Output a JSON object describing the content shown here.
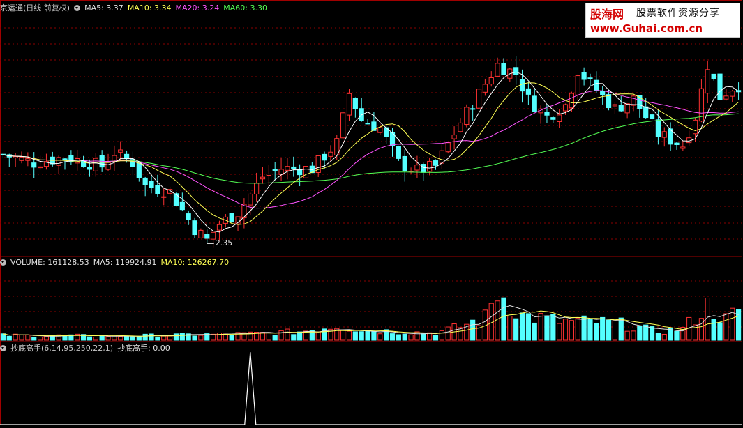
{
  "header": {
    "stock_name": "京运通(日线 前复权)",
    "ma5_label": "MA5: 3.37",
    "ma10_label": "MA10: 3.34",
    "ma20_label": "MA20: 3.24",
    "ma60_label": "MA60: 3.30"
  },
  "volume_header": {
    "title": "VOLUME: 161128.53",
    "ma5_label": "MA5: 119924.91",
    "ma10_label": "MA10: 126267.70"
  },
  "indicator_header": {
    "title": "抄底高手(6,14,95,250,22,1)",
    "value_label": "抄底高手: 0.00"
  },
  "low_marker": "2.35",
  "watermark": {
    "brand": "股海网",
    "tagline": "股票软件资源分享",
    "url": "www.Guhai.com.cn"
  },
  "colors": {
    "up": "#ff3232",
    "down": "#54ffff",
    "ma5": "#ffffff",
    "ma10": "#ffff54",
    "ma20": "#ff54ff",
    "ma60": "#54ff54",
    "grid": "#8b0000",
    "frame": "#a00000"
  },
  "chart_data": [
    {
      "type": "candlestick",
      "panel": "price",
      "y_unit": "price",
      "ylim": [
        2.25,
        4.35
      ],
      "count": 120,
      "close_path": [
        [
          0,
          3.12
        ],
        [
          5,
          3.05
        ],
        [
          10,
          3.1
        ],
        [
          16,
          3.02
        ],
        [
          18,
          3.14
        ],
        [
          21,
          3.05
        ],
        [
          23,
          2.85
        ],
        [
          27,
          2.8
        ],
        [
          31,
          2.48
        ],
        [
          33,
          2.38
        ],
        [
          35,
          2.52
        ],
        [
          38,
          2.62
        ],
        [
          42,
          2.93
        ],
        [
          45,
          3.0
        ],
        [
          50,
          3.0
        ],
        [
          54,
          3.22
        ],
        [
          56,
          3.65
        ],
        [
          58,
          3.42
        ],
        [
          61,
          3.35
        ],
        [
          64,
          3.05
        ],
        [
          67,
          2.98
        ],
        [
          70,
          3.02
        ],
        [
          74,
          3.4
        ],
        [
          77,
          3.65
        ],
        [
          80,
          3.9
        ],
        [
          83,
          3.82
        ],
        [
          85,
          3.6
        ],
        [
          88,
          3.45
        ],
        [
          91,
          3.55
        ],
        [
          93,
          3.85
        ],
        [
          96,
          3.68
        ],
        [
          99,
          3.52
        ],
        [
          102,
          3.6
        ],
        [
          104,
          3.45
        ],
        [
          106,
          3.3
        ],
        [
          108,
          3.25
        ],
        [
          110,
          3.2
        ],
        [
          112,
          3.45
        ],
        [
          114,
          3.9
        ],
        [
          116,
          3.62
        ],
        [
          118,
          3.7
        ],
        [
          119,
          3.72
        ]
      ],
      "ma_windows": {
        "ma5": 5,
        "ma10": 10,
        "ma20": 20,
        "ma60": 60
      },
      "annotations": [
        {
          "index": 33,
          "price": 2.35,
          "text": "2.35"
        }
      ]
    },
    {
      "type": "bar",
      "panel": "volume",
      "y_unit": "lots",
      "ylim": [
        0,
        380000
      ],
      "base_path": [
        [
          0,
          25000
        ],
        [
          20,
          22000
        ],
        [
          30,
          28000
        ],
        [
          40,
          34000
        ],
        [
          48,
          45000
        ],
        [
          54,
          78000
        ],
        [
          58,
          55000
        ],
        [
          64,
          45000
        ],
        [
          70,
          38000
        ],
        [
          74,
          72000
        ],
        [
          78,
          120000
        ],
        [
          80,
          260000
        ],
        [
          84,
          130000
        ],
        [
          90,
          100000
        ],
        [
          96,
          95000
        ],
        [
          100,
          85000
        ],
        [
          106,
          45000
        ],
        [
          110,
          60000
        ],
        [
          114,
          180000
        ],
        [
          117,
          110000
        ],
        [
          119,
          161128
        ]
      ],
      "ma_windows": {
        "ma5": 5,
        "ma10": 10
      }
    },
    {
      "type": "line",
      "panel": "indicator",
      "series": [
        {
          "name": "抄底高手",
          "values": [],
          "spikes": [
            {
              "index": 40,
              "value": 1
            }
          ]
        }
      ],
      "last_value": 0.0
    }
  ]
}
